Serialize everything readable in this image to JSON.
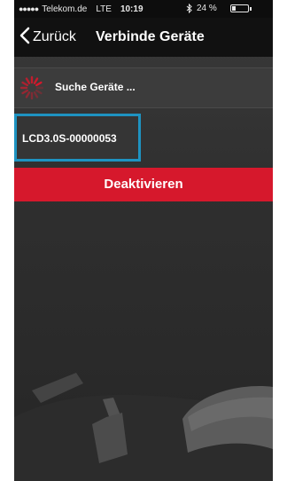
{
  "status_bar": {
    "signal_dots": "●●●●●",
    "carrier": "Telekom.de",
    "network": "LTE",
    "time": "10:19",
    "bluetooth_icon": "bluetooth-icon",
    "battery_percent": "24 %",
    "battery_level": 0.24
  },
  "nav": {
    "back_label": "Zurück",
    "back_icon": "chevron-left-icon",
    "title": "Verbinde Geräte"
  },
  "search": {
    "text": "Suche Geräte ...",
    "spinner_icon": "loading-spinner-icon",
    "spinner_color": "#d6182c"
  },
  "devices": [
    {
      "label": "LCD3.0S-00000053",
      "highlight_color": "#1e93c1"
    }
  ],
  "actions": {
    "deactivate_label": "Deaktivieren",
    "deactivate_color": "#d6182c"
  }
}
